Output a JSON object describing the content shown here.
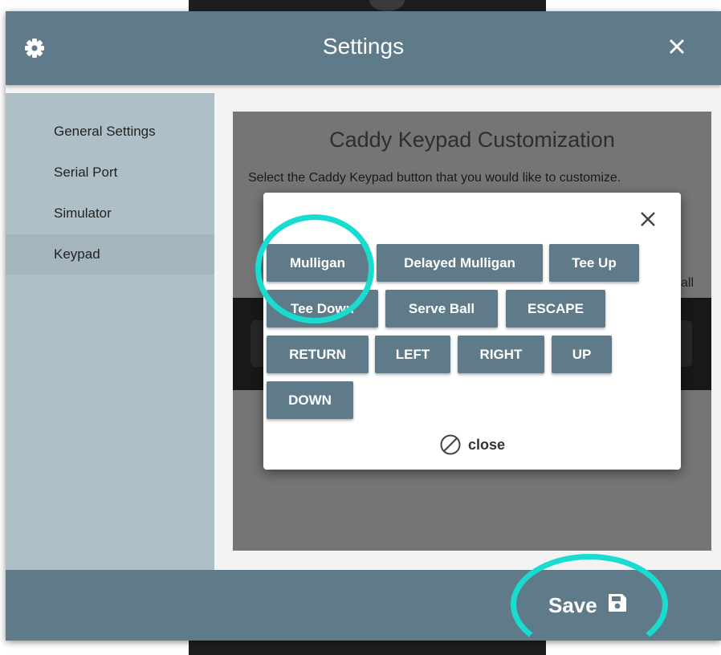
{
  "dialog": {
    "title": "Settings",
    "gear_icon": "gear-icon",
    "close_icon": "close-icon"
  },
  "sidebar": {
    "items": [
      {
        "label": "General Settings",
        "active": false
      },
      {
        "label": "Serial Port",
        "active": false
      },
      {
        "label": "Simulator",
        "active": false
      },
      {
        "label": "Keypad",
        "active": true
      }
    ]
  },
  "panel": {
    "title": "Caddy Keypad Customization",
    "description": "Select the Caddy Keypad button that you would like to customize.",
    "clipped_text": "all"
  },
  "popup": {
    "close_icon": "close-icon",
    "buttons": [
      "Mulligan",
      "Delayed Mulligan",
      "Tee Up",
      "Tee Down",
      "Serve Ball",
      "ESCAPE",
      "RETURN",
      "LEFT",
      "RIGHT",
      "UP",
      "DOWN"
    ],
    "close_label": "close",
    "close_link_icon": "cancel-icon"
  },
  "footer": {
    "save_label": "Save",
    "save_icon": "floppy-disk-icon"
  },
  "colors": {
    "header": "#5f7b89",
    "sidebar": "#afbfc7",
    "sidebar_active": "#a4b5be",
    "button": "#5f7b89",
    "highlight": "#19dcd0"
  }
}
